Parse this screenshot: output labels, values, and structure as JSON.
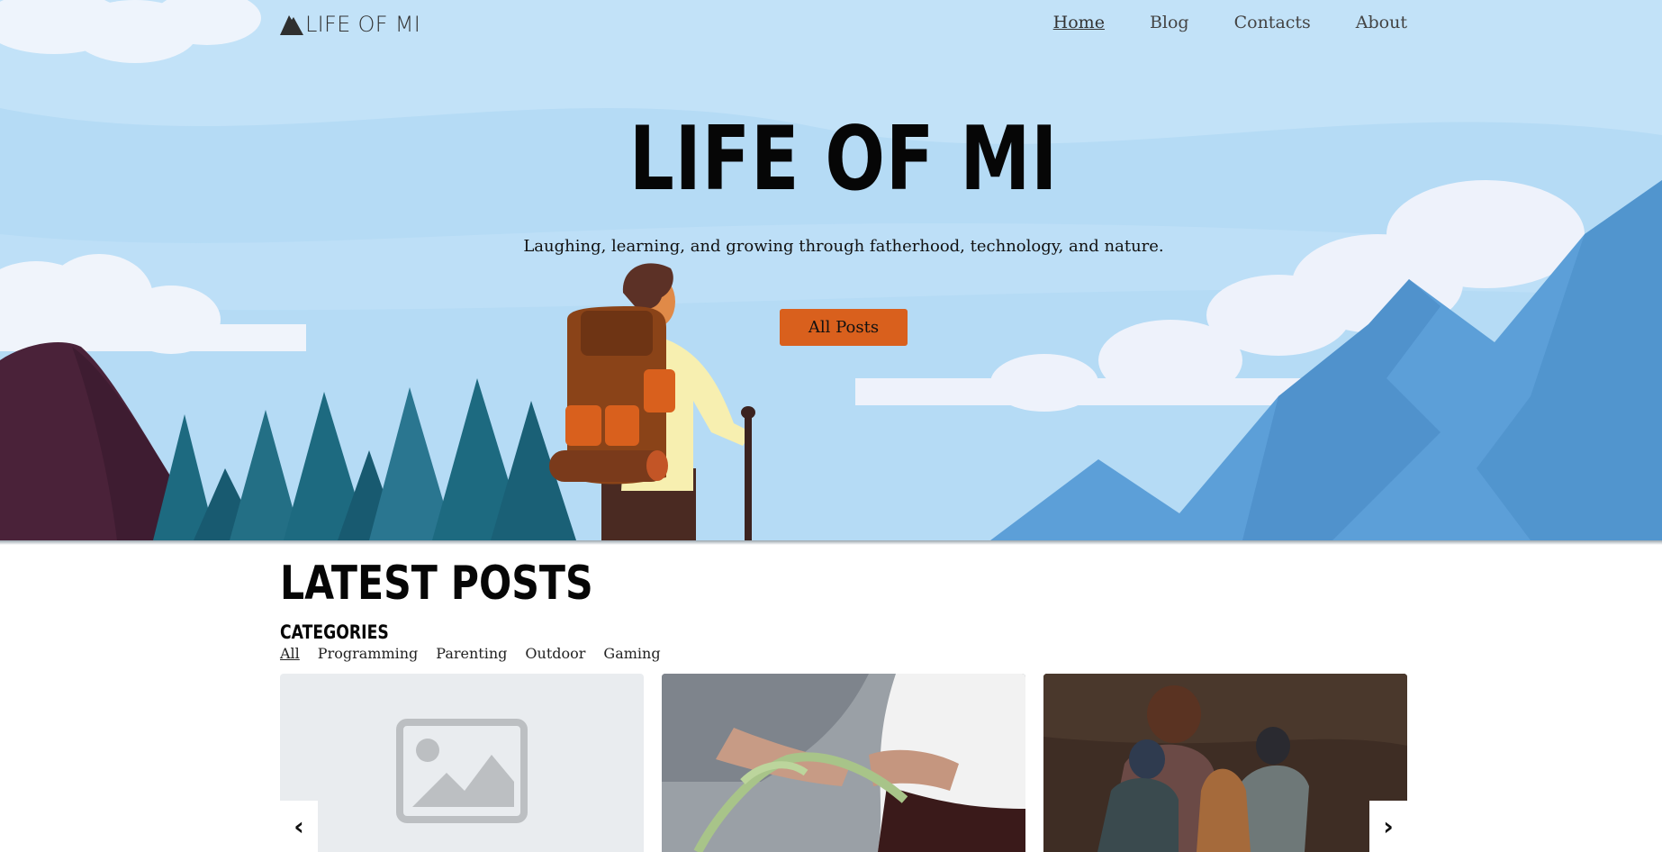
{
  "nav": {
    "logo_text": "LIFE OF MI",
    "links": [
      "Home",
      "Blog",
      "Contacts",
      "About"
    ]
  },
  "hero": {
    "title": "LIFE OF MI",
    "subtitle": "Laughing, learning, and growing through fatherhood, technology, and nature.",
    "button_label": "All Posts"
  },
  "latest": {
    "heading": "LATEST POSTS",
    "categories_heading": "CATEGORIES",
    "categories": [
      "All",
      "Programming",
      "Parenting",
      "Outdoor",
      "Gaming"
    ],
    "active_category": "All"
  },
  "carousel": {
    "prev_label": "‹",
    "next_label": "›"
  },
  "colors": {
    "sky": "#b3dcf7",
    "accent": "#d9601d",
    "mountain_left": "#4a2239",
    "trees": "#1e6a7f",
    "mountain_right": "#5a9fd6"
  }
}
